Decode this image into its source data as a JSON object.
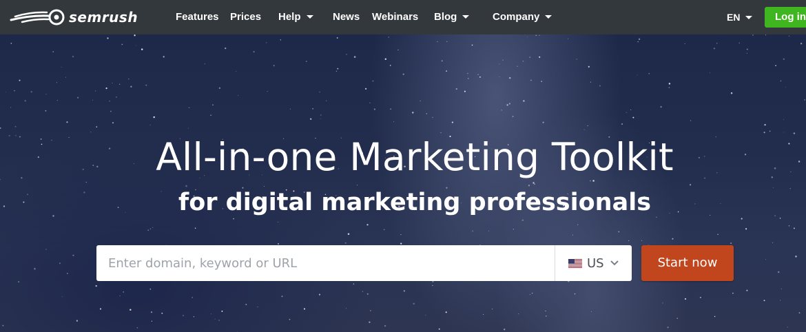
{
  "brand": {
    "name": "semrush",
    "logo_icon": "semrush-fire-logo-icon"
  },
  "nav": {
    "items": [
      {
        "label": "Features",
        "dropdown": false
      },
      {
        "label": "Prices",
        "dropdown": false
      },
      {
        "label": "Help",
        "dropdown": true
      },
      {
        "label": "News",
        "dropdown": false
      },
      {
        "label": "Webinars",
        "dropdown": false
      },
      {
        "label": "Blog",
        "dropdown": true
      },
      {
        "label": "Company",
        "dropdown": true
      }
    ],
    "language": "EN",
    "login_label": "Log in"
  },
  "hero": {
    "headline": "All-in-one Marketing Toolkit",
    "subheadline": "for digital marketing professionals",
    "search": {
      "placeholder": "Enter domain, keyword or URL",
      "value": "",
      "country_code": "US",
      "country_flag_icon": "us-flag-icon"
    },
    "cta_label": "Start now"
  },
  "colors": {
    "nav_bg": "#33383c",
    "login_green": "#3fb51f",
    "cta_orange": "#c1461d",
    "hero_bg": "#222c4c"
  }
}
